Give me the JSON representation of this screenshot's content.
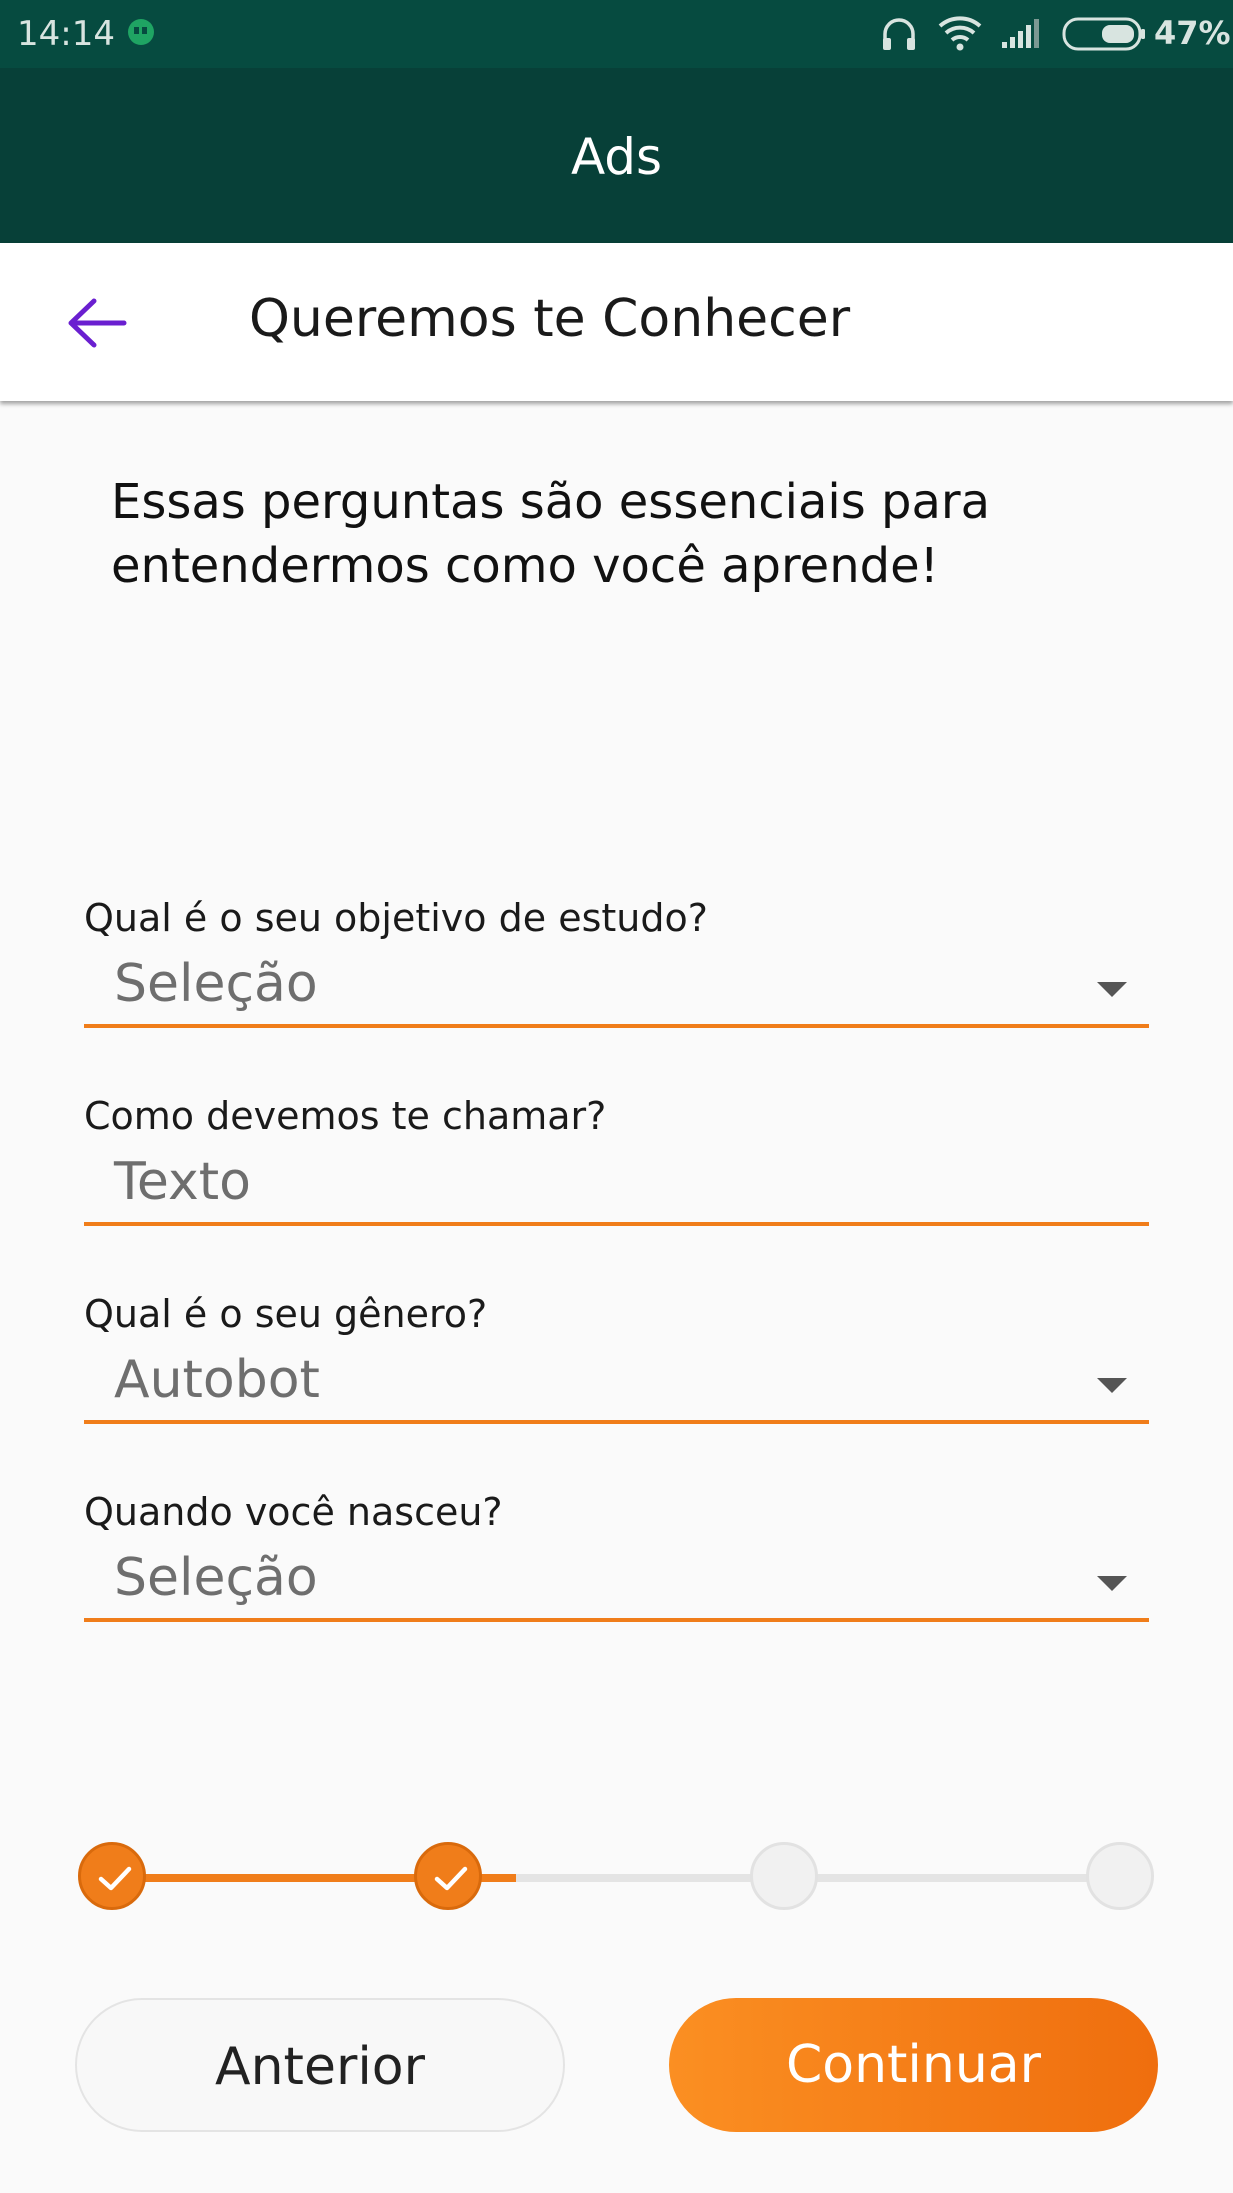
{
  "status_bar": {
    "time": "14:14",
    "battery_percent": "47%",
    "icons": [
      "hangouts-icon",
      "headphones-icon",
      "wifi-icon",
      "signal-icon",
      "battery-icon"
    ]
  },
  "app_header": {
    "title": "Ads"
  },
  "toolbar": {
    "back_icon": "arrow-left-icon",
    "title": "Queremos te Conhecer"
  },
  "intro": {
    "line1": "Essas perguntas são essenciais para",
    "line2": "entendermos como você aprende!"
  },
  "form": {
    "fields": [
      {
        "label": "Qual é o seu objetivo de estudo?",
        "value": "Seleção",
        "type": "select"
      },
      {
        "label": "Como devemos te chamar?",
        "value": "Texto",
        "type": "text"
      },
      {
        "label": "Qual é o seu gênero?",
        "value": "Autobot",
        "type": "select"
      },
      {
        "label": "Quando você nasceu?",
        "value": "Seleção",
        "type": "select"
      }
    ]
  },
  "stepper": {
    "total_steps": 4,
    "completed_steps": 2,
    "progress": 0.4
  },
  "buttons": {
    "previous_label": "Anterior",
    "continue_label": "Continuar"
  },
  "colors": {
    "status_bar": "#064b40",
    "app_header": "#074038",
    "accent_orange": "#f07d1a",
    "back_arrow": "#6a1fd0"
  }
}
